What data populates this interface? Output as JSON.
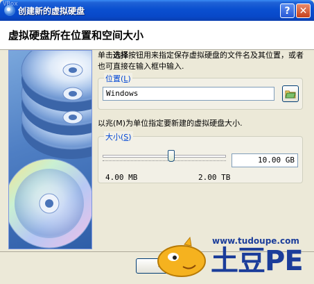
{
  "window": {
    "title": "创建新的虚拟硬盘",
    "help_label": "?",
    "close_label": "✕",
    "watermark": "VBox"
  },
  "header": {
    "heading": "虚拟硬盘所在位置和空间大小"
  },
  "intro": {
    "text_prefix": "单击",
    "text_bold": "选择",
    "text_suffix": "按钮用来指定保存虚拟硬盘的文件名及其位置，或者也可直接在输入框中输入."
  },
  "location": {
    "legend": "位置",
    "mnemonic": "L",
    "value": "Windows",
    "folder_icon": "folder-icon"
  },
  "size_note": "以兆(M)为单位指定要新建的虚拟硬盘大小.",
  "size": {
    "legend": "大小",
    "mnemonic": "S",
    "value": "10.00 GB",
    "min_label": "4.00 MB",
    "max_label": "2.00 TB",
    "slider_fraction": 0.56
  },
  "buttons": {
    "back_label": "<"
  },
  "logo": {
    "url": "www.tudoupe.com",
    "brand": "土豆PE"
  },
  "colors": {
    "title_bar": "#0A4FD0",
    "legend": "#0046D5",
    "dialog_bg": "#ECE9D8",
    "brand_blue": "#1B3D9A"
  }
}
